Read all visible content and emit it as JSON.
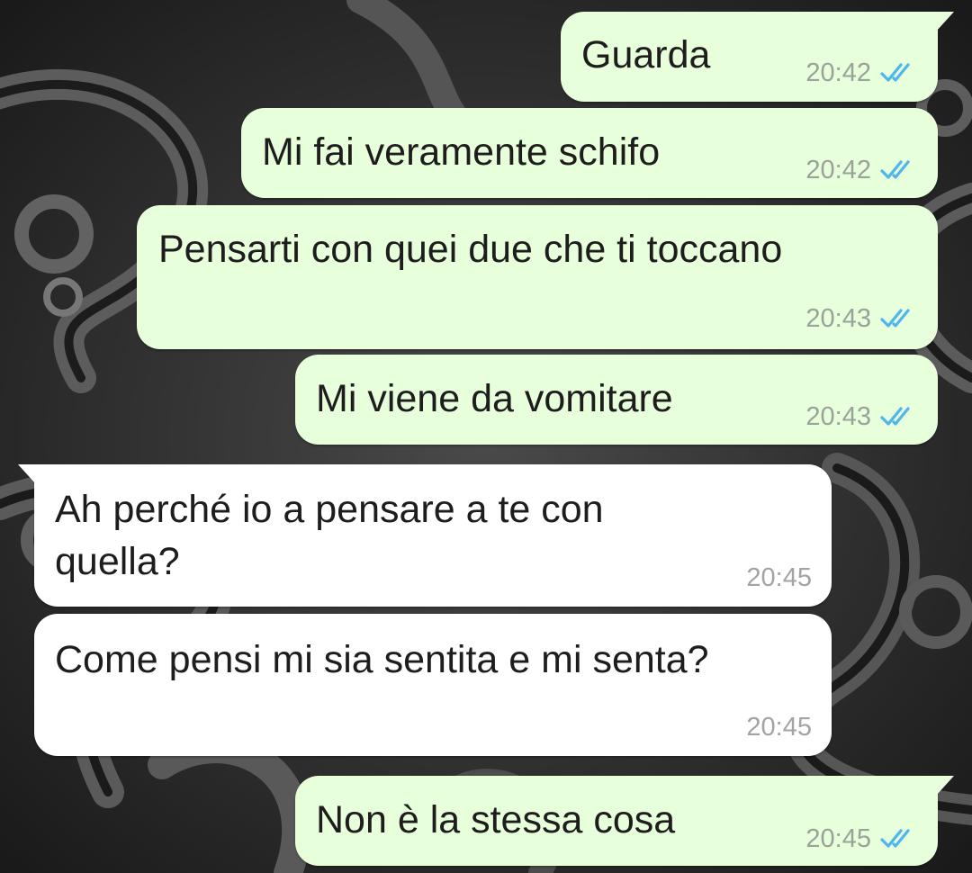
{
  "chat": {
    "messages": [
      {
        "direction": "outgoing",
        "text": "Guarda",
        "time": "20:42",
        "status": "read"
      },
      {
        "direction": "outgoing",
        "text": "Mi fai veramente schifo",
        "time": "20:42",
        "status": "read"
      },
      {
        "direction": "outgoing",
        "text": "Pensarti con quei due che ti toccano",
        "time": "20:43",
        "status": "read"
      },
      {
        "direction": "outgoing",
        "text": "Mi viene da vomitare",
        "time": "20:43",
        "status": "read"
      },
      {
        "direction": "incoming",
        "text_line1": "Ah perché io a pensare a te con",
        "text_line2": "quella?",
        "time": "20:45"
      },
      {
        "direction": "incoming",
        "text": "Come pensi mi sia sentita e mi senta?",
        "time": "20:45"
      },
      {
        "direction": "outgoing",
        "text": "Non è la stessa cosa",
        "time": "20:45",
        "status": "read"
      }
    ]
  },
  "icons": {
    "read_receipt": "double-check-icon"
  },
  "colors": {
    "outgoing_bubble": "#e7ffdb",
    "incoming_bubble": "#ffffff",
    "read_tick": "#4fb6ec",
    "wallpaper": "#2b2b2b"
  }
}
